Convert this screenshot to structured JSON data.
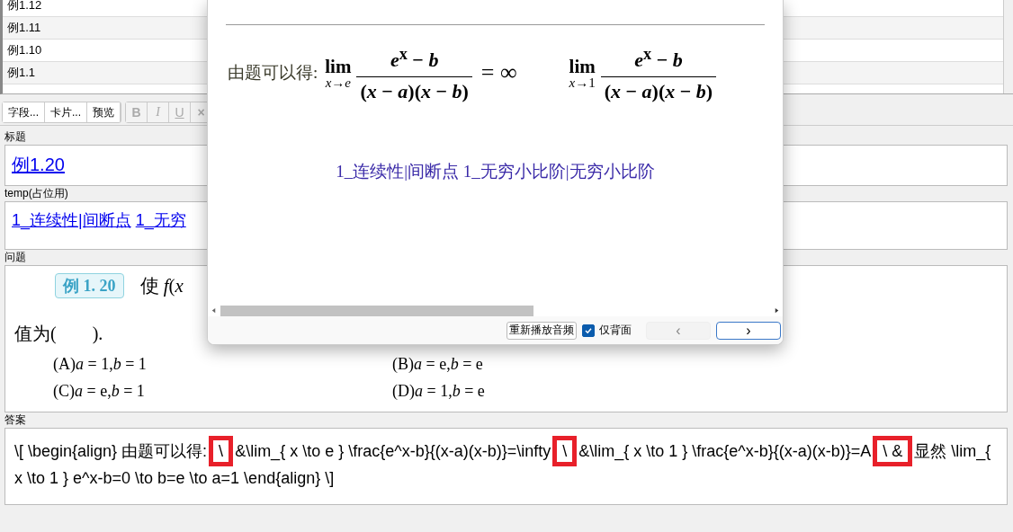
{
  "note_list": {
    "rows": [
      {
        "title": "例1.12"
      },
      {
        "title": "例1.11"
      },
      {
        "title": "例1.10"
      },
      {
        "title": "例1.1"
      }
    ]
  },
  "toolbar": {
    "buttons": [
      {
        "label": "字段...",
        "disabled": false
      },
      {
        "label": "卡片...",
        "disabled": false
      },
      {
        "label": "预览",
        "disabled": false
      },
      {
        "label": "B",
        "disabled": true
      },
      {
        "label": "I",
        "disabled": true
      },
      {
        "label": "U",
        "disabled": true
      },
      {
        "label": "×",
        "disabled": true
      }
    ]
  },
  "fields": [
    {
      "label": "标题",
      "kind": "links",
      "links": [
        "例1.20"
      ]
    },
    {
      "label": "temp(占位用)",
      "kind": "links",
      "links": [
        "1_连续性|间断点",
        "1_无穷"
      ]
    },
    {
      "label": "问题",
      "kind": "question",
      "badge": "例 1. 20",
      "first_line": "使 *f*(*x*",
      "prompt": "值为(　　).",
      "options": [
        "(A)*a* = 1,*b* = 1",
        "(B)*a* = e,*b* = e",
        "(C)*a* = e,*b* = 1",
        "(D)*a* = 1,*b* = e"
      ]
    },
    {
      "label": "答案",
      "kind": "source",
      "segments": [
        {
          "text": "\\[ \\begin{align} 由题可以得:",
          "marked": false
        },
        {
          "text": "\\ ",
          "marked": true
        },
        {
          "text": "&\\lim_{ x \\to e } \\frac{e^x-b}{(x-a)(x-b)}=\\infty",
          "marked": false
        },
        {
          "text": " \\ ",
          "marked": true
        },
        {
          "text": "&\\lim_{ x \\to 1 } \\frac{e^x-b}{(x-a)(x-b)}=A",
          "marked": false
        },
        {
          "text": " \\ &",
          "marked": true
        },
        {
          "text": "显然 \\lim_{ x \\to 1 } e^x-b=0 \\to b=e \\to a=1 \\end{align} \\]",
          "marked": false
        }
      ]
    }
  ],
  "preview": {
    "lead": "由题可以得:",
    "limits": [
      {
        "lim": "lim",
        "sub": "*x*→*e*",
        "numerator": "*e*$^{x}$ − *b*",
        "denominator": "(*x* − *a*)(*x* − *b*)",
        "rhs": "= ∞"
      },
      {
        "lim": "lim",
        "sub": "*x*→1",
        "numerator": "*e*$^{x}$ − *b*",
        "denominator": "(*x* − *a*)(*x* − *b*)"
      }
    ],
    "tags": "1_连续性|间断点 1_无穷小比阶|无穷小比阶",
    "replay_button": "重新播放音频",
    "back_only": {
      "label": "仅背面",
      "checked": true
    },
    "prev_button": {
      "label": "‹",
      "disabled": true
    },
    "next_button": {
      "label": "›",
      "disabled": false
    }
  }
}
